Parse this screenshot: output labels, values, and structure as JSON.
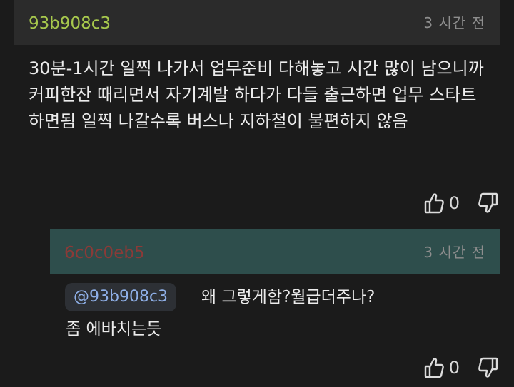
{
  "colors": {
    "background": "#1b1b1b",
    "comment_header_bg": "#2b2b2b",
    "reply_header_bg": "#2e4e4c",
    "author_color": "#a7c84d",
    "reply_author_color": "#8c3a37",
    "mention_color": "#8fb0e8",
    "timestamp_color": "#8e8e8e"
  },
  "comment": {
    "author": "93b908c3",
    "timestamp": "3 시간 전",
    "body": "30분-1시간 일찍 나가서 업무준비 다해놓고 시간 많이 남으니까 커피한잔 때리면서 자기계발 하다가 다들 출근하면 업무 스타트 하면됨 일찍 나갈수록 버스나 지하철이 불편하지 않음",
    "likes": "0",
    "like_icon": "thumbs-up-icon",
    "dislike_icon": "thumbs-down-icon"
  },
  "reply": {
    "author": "6c0c0eb5",
    "timestamp": "3 시간 전",
    "mention": "@93b908c3",
    "text_line1": "왜 그렇게함?월급더주나?",
    "text_line2": "좀 에바치는듯",
    "likes": "0",
    "like_icon": "thumbs-up-icon",
    "dislike_icon": "thumbs-down-icon"
  }
}
